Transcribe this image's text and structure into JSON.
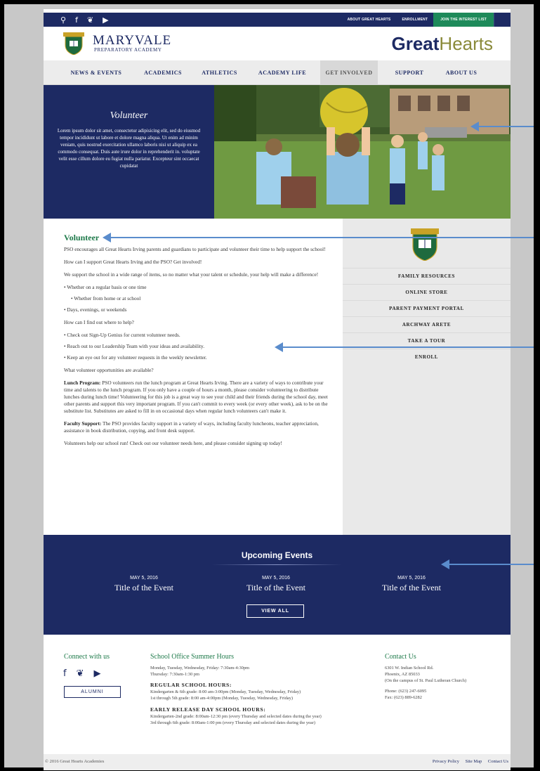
{
  "topbar": {
    "icons": [
      "search-icon",
      "facebook-icon",
      "twitter-icon",
      "youtube-icon"
    ],
    "about": "ABOUT GREAT HEARTS",
    "enrollment": "ENROLLMENT",
    "interest": "JOIN THE INTEREST LIST"
  },
  "header": {
    "school_name": "MARYVALE",
    "school_sub": "PREPARATORY ACADEMY",
    "brand_1": "Great",
    "brand_2": "Hearts"
  },
  "nav": {
    "items": [
      "NEWS & EVENTS",
      "ACADEMICS",
      "ATHLETICS",
      "ACADEMY LIFE",
      "GET INVOLVED",
      "SUPPORT",
      "ABOUT US"
    ],
    "active": "GET INVOLVED"
  },
  "hero": {
    "title": "Volunteer",
    "text": "Lorem ipsum dolor sit amet, consectetur adipisicing elit, sed do eiusmod tempor incididunt ut labore et dolore magna aliqua. Ut enim ad minim veniam, quis nostrud exercitation ullamco laboris nisi ut aliquip ex ea commodo consequat. Duis aute irure dolor in reprehenderit in. voluptate velit esse cillum dolore eu fugiat nulla pariatur. Excepteur sint occaecat cupidatat"
  },
  "content": {
    "heading": "Volunteer",
    "p1": "PSO encourages all Great Hearts Irving parents and guardians to participate and volunteer their time to help support the school!",
    "p2": "How can I support Great Hearts Irving and the PSO? Get involved!",
    "p3": "We support the school in a wide range of items, so no matter what your talent or schedule, your help will make a difference!",
    "list1": [
      "• Whether on a regular basis or one time",
      "• Whether from home or at school",
      "• Days, evenings, or weekends"
    ],
    "p4": "How can I find out where to help?",
    "list2": [
      "• Check out Sign-Up Genius for current volunteer needs.",
      "• Reach out to our Leadership Team with your ideas and availability.",
      "• Keep an eye out for any volunteer requests in the weekly newsletter."
    ],
    "p5": "What volunteer opportunities are available?",
    "lunch_label": "Lunch Program:",
    "lunch_text": " PSO volunteers run the lunch program at Great Hearts Irving.  There are a variety of ways to contribute your time and talents to the lunch program.  If you only have a couple of hours a month, please consider volunteering to distribute lunches during lunch time!  Volunteering for this job is a great way to see your child and their friends during the school day, meet other parents and support this very important program. If you can't commit to every week (or every other week), ask to be on the substitute list. Substitutes are asked to fill in on occasional days when regular lunch volunteers can't make it.",
    "faculty_label": "Faculty Support:",
    "faculty_text": " The PSO provides faculty support in a variety of ways, including faculty luncheons, teacher appreciation, assistance in book distribution, copying, and front desk support.",
    "p_last": "Volunteers help our school run! Check out our volunteer needs here, and please consider signing up today!"
  },
  "sidebar": {
    "links": [
      "FAMILY RESOURCES",
      "ONLINE STORE",
      "PARENT PAYMENT PORTAL",
      "ARCHWAY ARETE",
      "TAKE A TOUR",
      "ENROLL"
    ]
  },
  "events": {
    "title": "Upcoming Events",
    "items": [
      {
        "date": "MAY 5, 2016",
        "title": "Title of the Event"
      },
      {
        "date": "MAY 5, 2016",
        "title": "Title of the Event"
      },
      {
        "date": "MAY 5, 2016",
        "title": "Title of the Event"
      }
    ],
    "view_all": "VIEW ALL"
  },
  "footer": {
    "connect_title": "Connect with us",
    "alumni": "ALUMNI",
    "hours_title": "School Office Summer Hours",
    "hours_line1": "Monday, Tuesday, Wednesday, Friday: 7:30am-4:30pm",
    "hours_line2": "Thursday: 7:30am-1:30 pm",
    "regular_title": "REGULAR SCHOOL HOURS:",
    "regular_line1": "Kindergarten & 6th grade: 8:00 am-3:00pm (Monday, Tuesday, Wednesday, Friday)",
    "regular_line2": "1st through 5th grade: 8:00 am-4:00pm (Monday, Tuesday, Wednesday, Friday)",
    "early_title": "EARLY RELEASE DAY SCHOOL HOURS:",
    "early_line1": "Kindergarten-2nd grade: 8:00am-12:30 pm (every Thursday and selected dates during the year)",
    "early_line2": "3rd through 6th grade: 8:00am-1:00 pm (every Thursday and selected dates during the year)",
    "contact_title": "Contact Us",
    "address1": "6301 W. Indian School Rd.",
    "address2": "Phoenix, AZ 85033",
    "address3": "(On the campus of St. Paul Lutheran Church)",
    "phone": "Phone: (623) 247-6095",
    "fax": "Fax: (623) 889-6282",
    "copyright": "© 2016 Great Hearts Academies",
    "legal": [
      "Privacy Policy",
      "Site Map",
      "Contact Us"
    ]
  },
  "colors": {
    "navy": "#1d2a63",
    "green": "#1e7a4a",
    "annotation_arrow": "#5a8ccc"
  }
}
